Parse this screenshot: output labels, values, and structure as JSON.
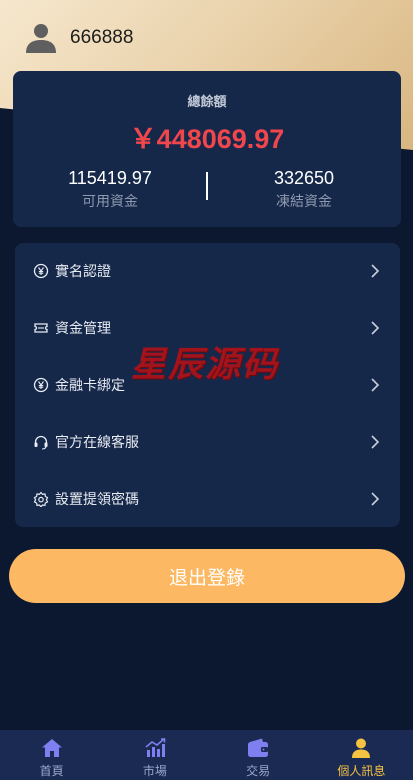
{
  "user": {
    "username": "666888"
  },
  "balance": {
    "title": "總餘額",
    "amount": "￥448069.97",
    "available_value": "115419.97",
    "available_label": "可用資金",
    "frozen_value": "332650",
    "frozen_label": "凍結資金"
  },
  "menu": {
    "items": [
      {
        "label": "實名認證",
        "icon": "yen-circle-icon"
      },
      {
        "label": "資金管理",
        "icon": "ticket-icon"
      },
      {
        "label": "金融卡綁定",
        "icon": "yen-circle-icon"
      },
      {
        "label": "官方在線客服",
        "icon": "headset-icon"
      },
      {
        "label": "設置提領密碼",
        "icon": "gear-icon"
      }
    ]
  },
  "watermark": "星辰源码",
  "logout_label": "退出登錄",
  "tabbar": {
    "tabs": [
      {
        "label": "首頁",
        "icon": "home-icon"
      },
      {
        "label": "市場",
        "icon": "chart-icon"
      },
      {
        "label": "交易",
        "icon": "wallet-icon"
      },
      {
        "label": "個人訊息",
        "icon": "user-icon"
      }
    ],
    "active_index": 3
  },
  "colors": {
    "accent": "#fcb862",
    "balance_red": "#f2464d",
    "active_tab": "#f5c242",
    "background": "#0b1830",
    "card": "#16284a"
  }
}
